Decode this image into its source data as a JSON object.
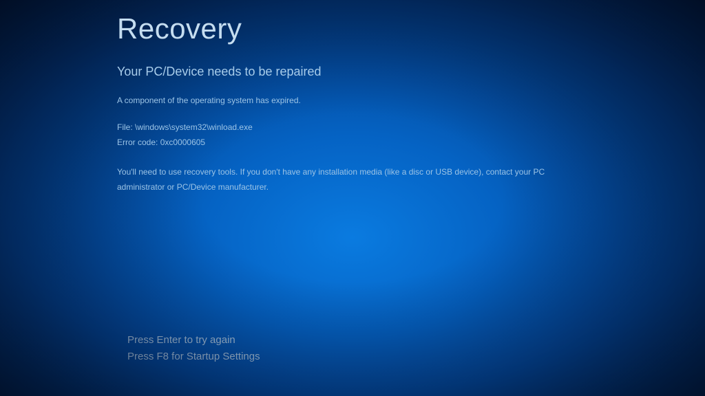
{
  "title": "Recovery",
  "subtitle": "Your PC/Device needs to be repaired",
  "description": "A component of the operating system has expired.",
  "file_label": "File:",
  "file_path": "\\windows\\system32\\winload.exe",
  "error_label": "Error code:",
  "error_code": "0xc0000605",
  "instructions": "You'll need to use recovery tools. If you don't have any installation media (like a disc or USB device), contact your PC administrator or PC/Device manufacturer.",
  "options": {
    "enter": "Press Enter to try again",
    "f8": "Press F8 for Startup Settings"
  }
}
